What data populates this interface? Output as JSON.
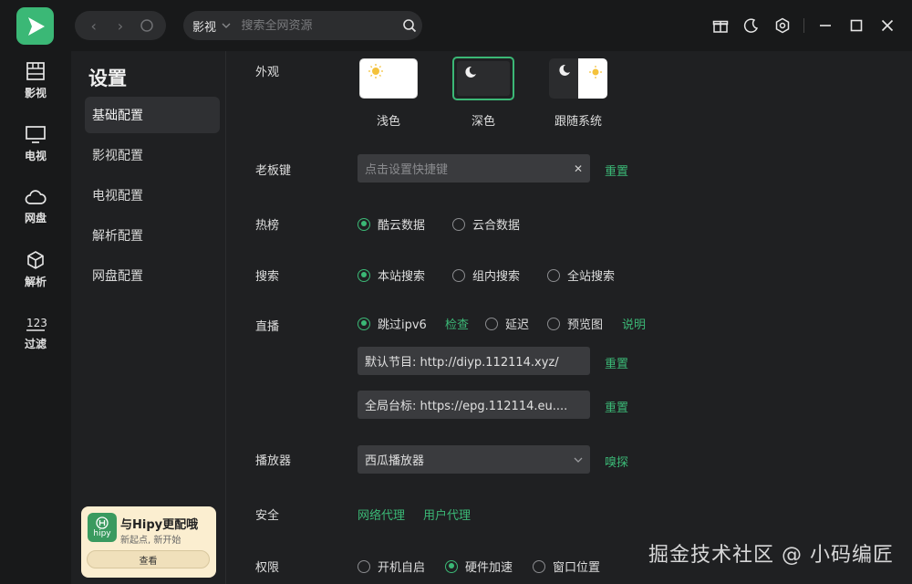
{
  "header": {
    "search_category": "影视",
    "search_placeholder": "搜索全网资源"
  },
  "rail": {
    "items": [
      {
        "label": "影视",
        "icon": "film-icon"
      },
      {
        "label": "电视",
        "icon": "tv-icon"
      },
      {
        "label": "网盘",
        "icon": "cloud-icon"
      },
      {
        "label": "解析",
        "icon": "cube-icon"
      },
      {
        "label": "过滤",
        "icon": "123-icon"
      }
    ]
  },
  "settings": {
    "title": "设置",
    "menu": [
      "基础配置",
      "影视配置",
      "电视配置",
      "解析配置",
      "网盘配置"
    ],
    "active_index": 0
  },
  "promo": {
    "logo_text": "hipy",
    "title": "与Hipy更配哦",
    "subtitle": "新起点, 新开始",
    "button": "查看"
  },
  "appearance": {
    "label": "外观",
    "options": [
      "浅色",
      "深色",
      "跟随系统"
    ],
    "selected": "深色"
  },
  "boss_key": {
    "label": "老板键",
    "placeholder": "点击设置快捷键",
    "reset": "重置"
  },
  "hot_list": {
    "label": "热榜",
    "options": [
      "酷云数据",
      "云合数据"
    ],
    "selected": "酷云数据"
  },
  "search": {
    "label": "搜索",
    "options": [
      "本站搜索",
      "组内搜索",
      "全站搜索"
    ],
    "selected": "本站搜索"
  },
  "live": {
    "label": "直播",
    "opt_skip": "跳过ipv6",
    "check": "检查",
    "opt_delay": "延迟",
    "opt_preview": "预览图",
    "explain": "说明",
    "default_channel": "默认节目: http://diyp.112114.xyz/",
    "global_logo": "全局台标: https://epg.112114.eu....",
    "reset": "重置",
    "reset2": "重置"
  },
  "player": {
    "label": "播放器",
    "value": "西瓜播放器",
    "sniff": "嗅探"
  },
  "security": {
    "label": "安全",
    "network_proxy": "网络代理",
    "user_agent": "用户代理"
  },
  "permission": {
    "label": "权限",
    "options": [
      "开机自启",
      "硬件加速",
      "窗口位置"
    ],
    "selected": "硬件加速"
  },
  "watermark": "掘金技术社区 @ 小码编匠",
  "colors": {
    "accent": "#3bb876",
    "background": "#1f2022",
    "rail": "#18191a"
  }
}
